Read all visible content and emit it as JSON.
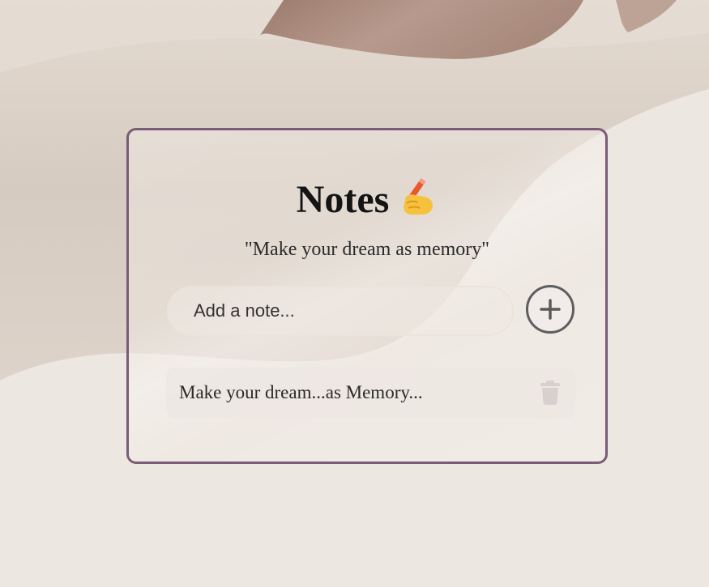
{
  "app": {
    "title": "Notes",
    "title_icon": "writing-hand-icon",
    "tagline": "\"Make your dream as memory\""
  },
  "composer": {
    "placeholder": "Add a note...",
    "value": "",
    "add_icon": "plus-icon"
  },
  "notes": [
    {
      "text": "Make your dream...as Memory...",
      "delete_icon": "trash-icon"
    }
  ],
  "colors": {
    "card_border": "#7a5c78",
    "title_text": "#141414",
    "add_button_border": "#5e5e5e",
    "trash_icon": "#d8d0cf"
  }
}
